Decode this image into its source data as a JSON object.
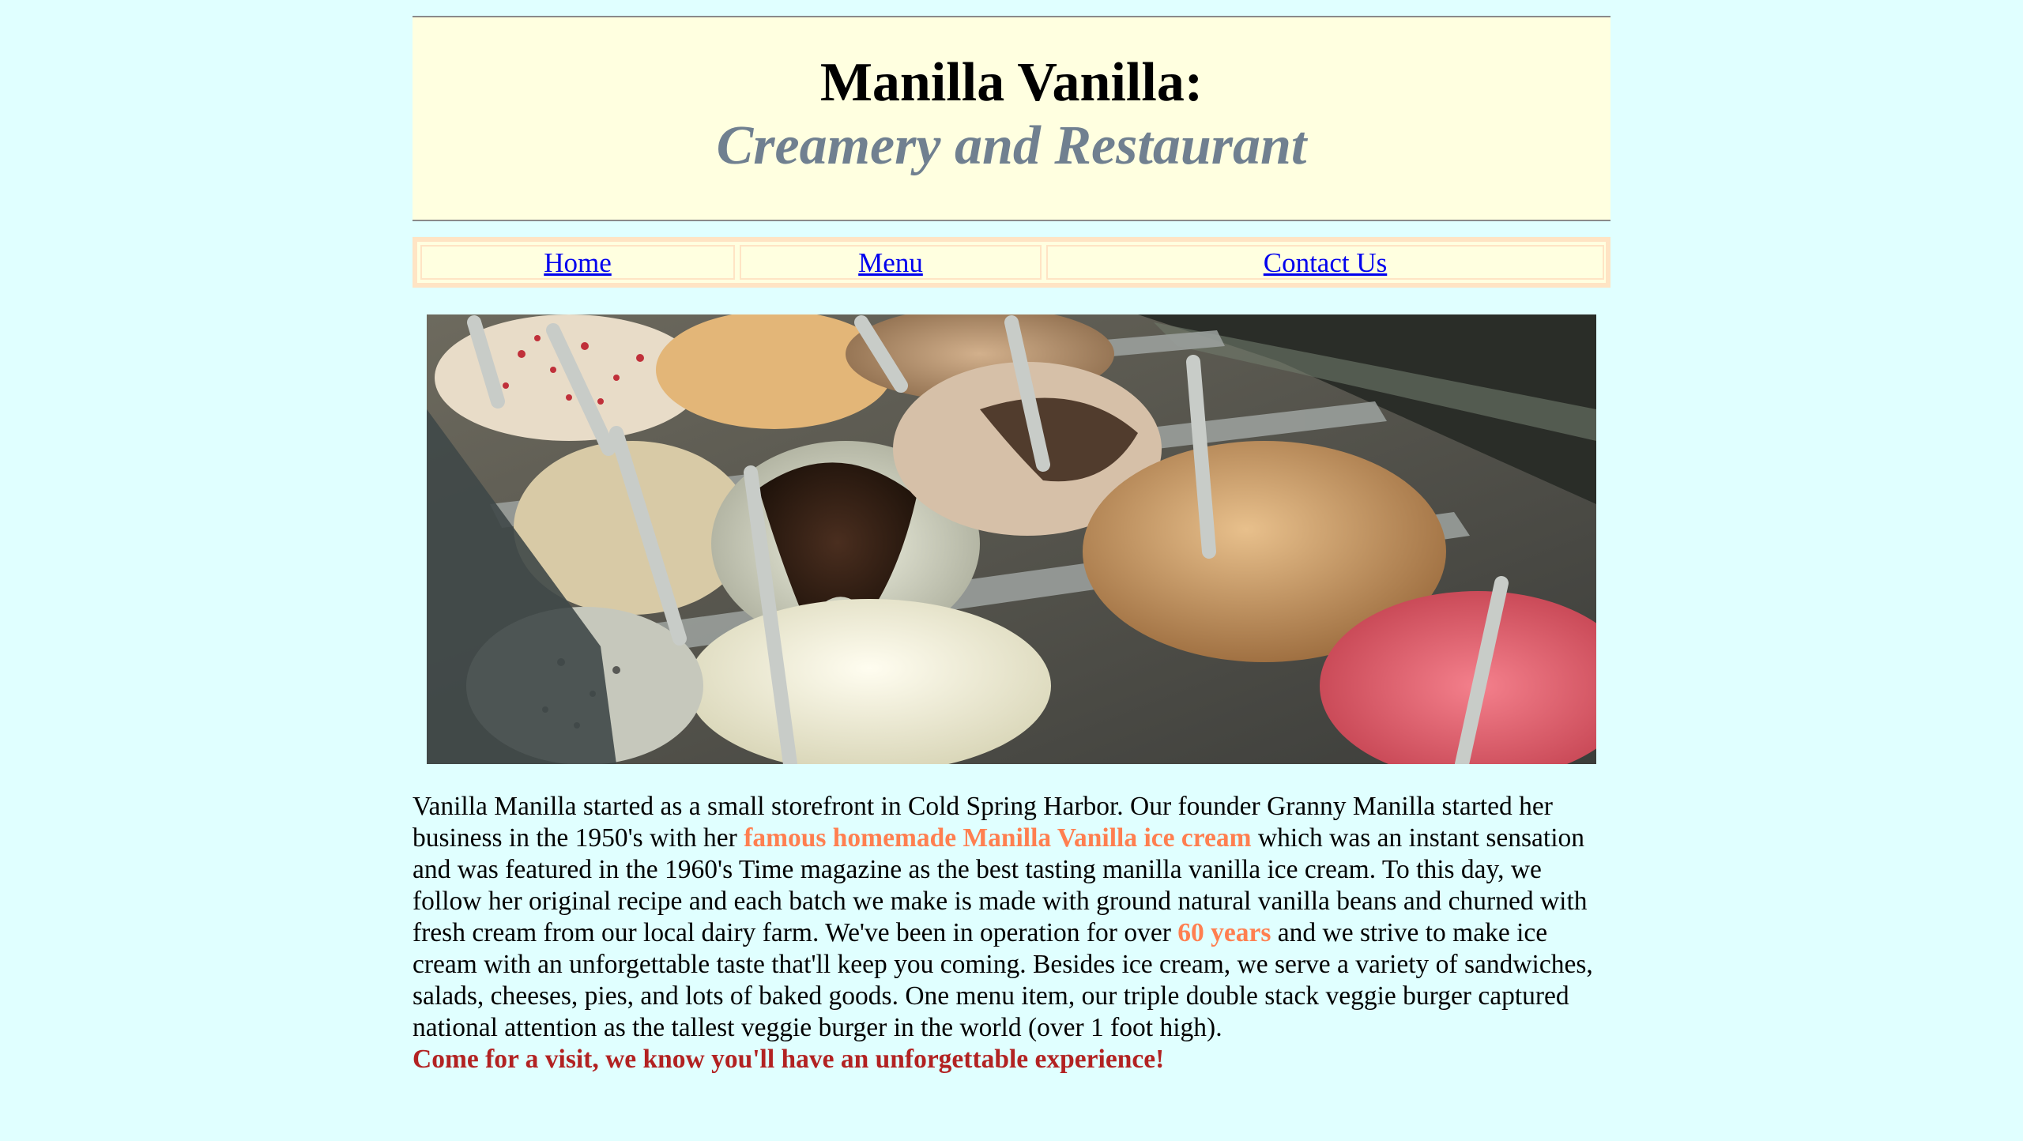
{
  "header": {
    "title": "Manilla Vanilla:",
    "subtitle": "Creamery and Restaurant"
  },
  "nav": {
    "items": [
      {
        "label": "Home"
      },
      {
        "label": "Menu"
      },
      {
        "label": "Contact Us"
      }
    ]
  },
  "hero": {
    "alt": "ice cream display case"
  },
  "content": {
    "p1": "Vanilla Manilla started as a small storefront in Cold Spring Harbor. Our founder Granny Manilla started her business in the 1950's with her ",
    "highlight1": "famous homemade Manilla Vanilla ice cream",
    "p2": " which was an instant sensation and was featured in the 1960's Time magazine as the best tasting manilla vanilla ice cream. To this day, we follow her original recipe and each batch we make is made with ground natural vanilla beans and churned with fresh cream from our local dairy farm. We've been in operation for over ",
    "highlight2": "60 years",
    "p3": " and we strive to make ice cream with an unforgettable taste that'll keep you coming. Besides ice cream, we serve a variety of sandwiches, salads, cheeses, pies, and lots of baked goods. One menu item, our triple double stack veggie burger captured national attention as the tallest veggie burger in the world (over 1 foot high).",
    "closing": "Come for a visit, we know you'll have an unforgettable experience!"
  },
  "colors": {
    "page_bg": "#e0ffff",
    "header_bg": "#ffffe0",
    "subtitle": "#708090",
    "highlight": "#ff7f50",
    "closing": "#b22222",
    "link": "#0000ee"
  }
}
